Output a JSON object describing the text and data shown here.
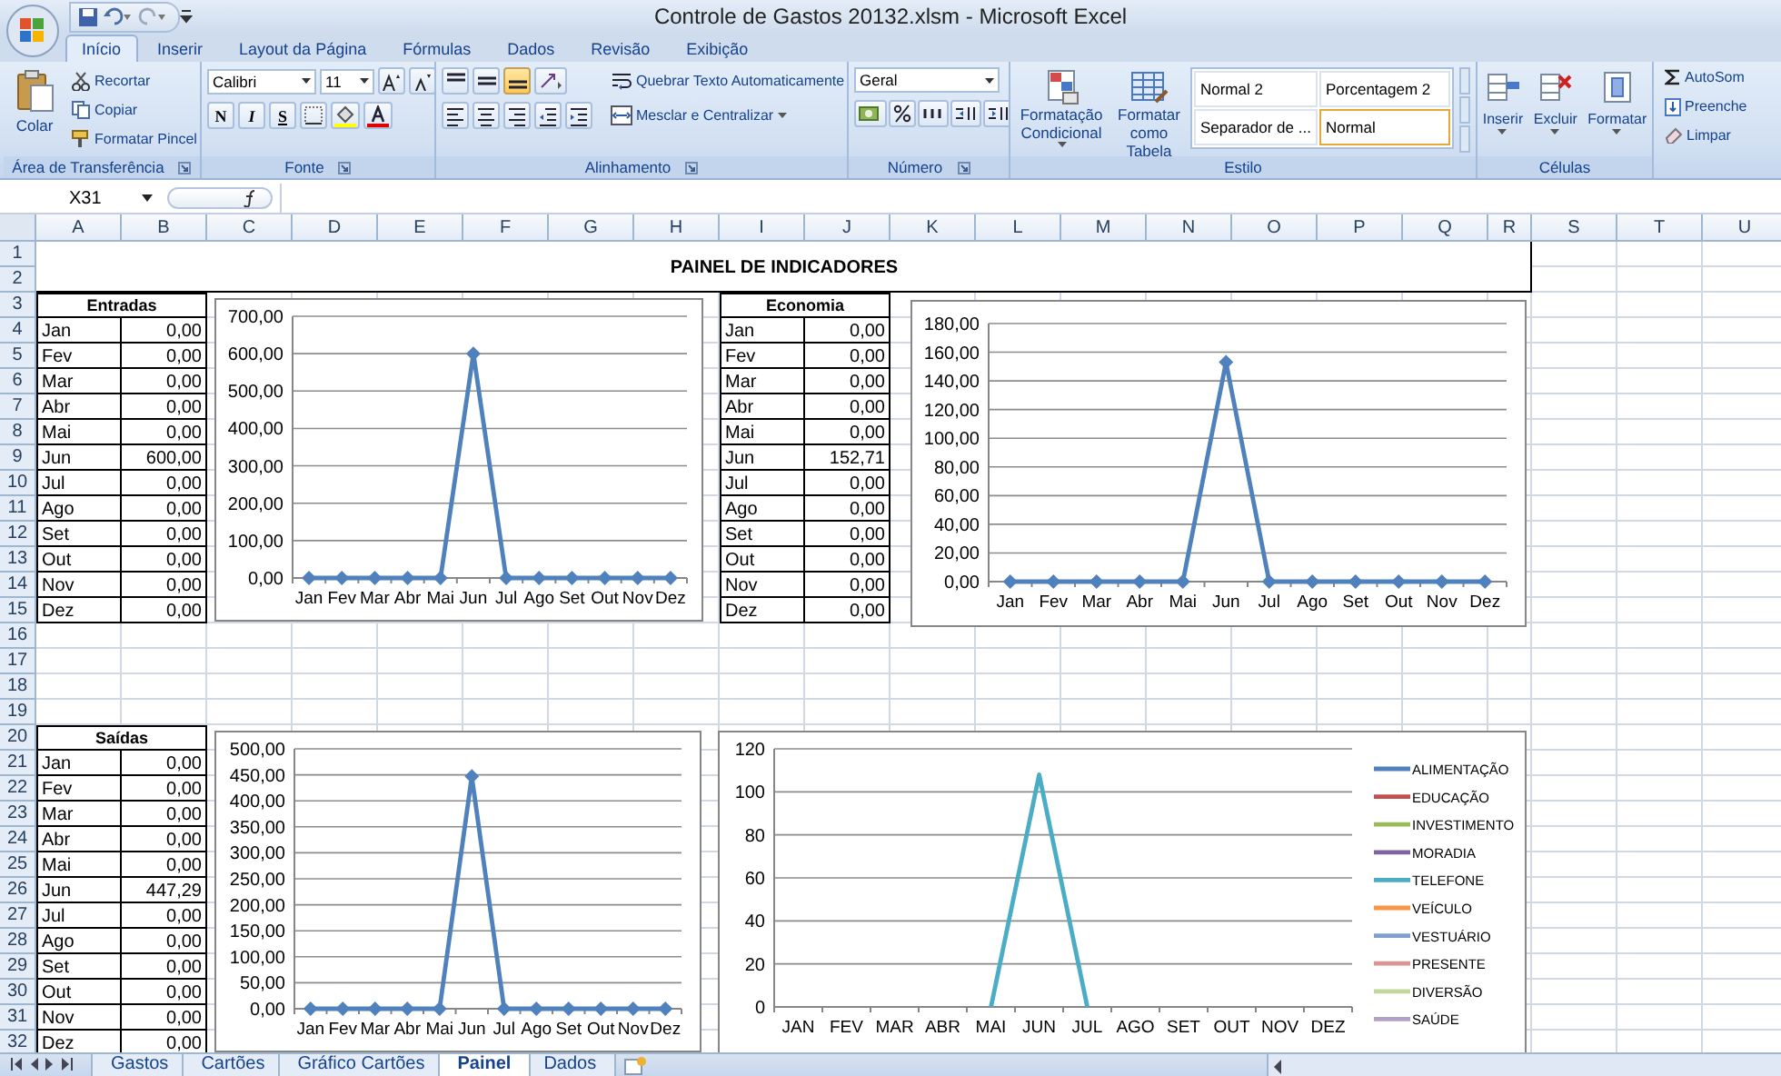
{
  "window": {
    "title": "Controle de Gastos 20132.xlsm - Microsoft Excel"
  },
  "ribbon": {
    "tabs": [
      {
        "label": "Início",
        "selected": true
      },
      {
        "label": "Inserir",
        "selected": false
      },
      {
        "label": "Layout da Página",
        "selected": false
      },
      {
        "label": "Fórmulas",
        "selected": false
      },
      {
        "label": "Dados",
        "selected": false
      },
      {
        "label": "Revisão",
        "selected": false
      },
      {
        "label": "Exibição",
        "selected": false
      }
    ],
    "groups": [
      {
        "kind": "clipboard",
        "label": "Área de Transferência",
        "big": "Colar",
        "small": [
          "Recortar",
          "Copiar",
          "Formatar Pincel"
        ]
      },
      {
        "kind": "font",
        "label": "Fonte",
        "font": "Calibri",
        "size": "11",
        "styles": [
          "N",
          "I",
          "S"
        ]
      },
      {
        "kind": "alignment",
        "label": "Alinhamento",
        "vertical_align": [
          {
            "selected": false
          },
          {
            "selected": false
          },
          {
            "selected": true
          }
        ],
        "wrap": "Quebrar Texto Automaticamente",
        "merge": "Mesclar e Centralizar"
      },
      {
        "kind": "number",
        "label": "Número",
        "format": "Geral"
      },
      {
        "kind": "styles",
        "label": "Estilo",
        "buttons": [
          "Formatação Condicional",
          "Formatar como Tabela"
        ],
        "gallery": [
          {
            "label": "Normal 2",
            "selected": false
          },
          {
            "label": "Porcentagem 2",
            "selected": false
          },
          {
            "label": "Separador de ...",
            "selected": false
          },
          {
            "label": "Normal",
            "selected": true
          }
        ]
      },
      {
        "kind": "cells",
        "label": "Células",
        "buttons": [
          "Inserir",
          "Excluir",
          "Formatar"
        ]
      },
      {
        "kind": "editing",
        "small": [
          "AutoSom",
          "Preenche",
          "Limpar"
        ]
      }
    ]
  },
  "formula_bar": {
    "name_box": "X31"
  },
  "sheet": {
    "columns": [
      "A",
      "B",
      "C",
      "D",
      "E",
      "F",
      "G",
      "H",
      "I",
      "J",
      "K",
      "L",
      "M",
      "N",
      "O",
      "P",
      "Q",
      "R",
      "S",
      "T",
      "U"
    ],
    "rows": [
      "1",
      "2",
      "3",
      "4",
      "5",
      "6",
      "7",
      "8",
      "9",
      "10",
      "11",
      "12",
      "13",
      "14",
      "15",
      "16",
      "17",
      "18",
      "19",
      "20",
      "21",
      "22",
      "23",
      "24",
      "25",
      "26",
      "27",
      "28",
      "29",
      "30",
      "31",
      "32"
    ],
    "title": "PAINEL DE INDICADORES",
    "tables": [
      {
        "heading": "Entradas",
        "rows": [
          {
            "month": "Jan",
            "value": "0,00"
          },
          {
            "month": "Fev",
            "value": "0,00"
          },
          {
            "month": "Mar",
            "value": "0,00"
          },
          {
            "month": "Abr",
            "value": "0,00"
          },
          {
            "month": "Mai",
            "value": "0,00"
          },
          {
            "month": "Jun",
            "value": "600,00"
          },
          {
            "month": "Jul",
            "value": "0,00"
          },
          {
            "month": "Ago",
            "value": "0,00"
          },
          {
            "month": "Set",
            "value": "0,00"
          },
          {
            "month": "Out",
            "value": "0,00"
          },
          {
            "month": "Nov",
            "value": "0,00"
          },
          {
            "month": "Dez",
            "value": "0,00"
          }
        ]
      },
      {
        "heading": "Economia",
        "rows": [
          {
            "month": "Jan",
            "value": "0,00"
          },
          {
            "month": "Fev",
            "value": "0,00"
          },
          {
            "month": "Mar",
            "value": "0,00"
          },
          {
            "month": "Abr",
            "value": "0,00"
          },
          {
            "month": "Mai",
            "value": "0,00"
          },
          {
            "month": "Jun",
            "value": "152,71"
          },
          {
            "month": "Jul",
            "value": "0,00"
          },
          {
            "month": "Ago",
            "value": "0,00"
          },
          {
            "month": "Set",
            "value": "0,00"
          },
          {
            "month": "Out",
            "value": "0,00"
          },
          {
            "month": "Nov",
            "value": "0,00"
          },
          {
            "month": "Dez",
            "value": "0,00"
          }
        ]
      },
      {
        "heading": "Saídas",
        "rows": [
          {
            "month": "Jan",
            "value": "0,00"
          },
          {
            "month": "Fev",
            "value": "0,00"
          },
          {
            "month": "Mar",
            "value": "0,00"
          },
          {
            "month": "Abr",
            "value": "0,00"
          },
          {
            "month": "Mai",
            "value": "0,00"
          },
          {
            "month": "Jun",
            "value": "447,29"
          },
          {
            "month": "Jul",
            "value": "0,00"
          },
          {
            "month": "Ago",
            "value": "0,00"
          },
          {
            "month": "Set",
            "value": "0,00"
          },
          {
            "month": "Out",
            "value": "0,00"
          },
          {
            "month": "Nov",
            "value": "0,00"
          },
          {
            "month": "Dez",
            "value": "0,00"
          }
        ]
      }
    ],
    "charts": [
      {
        "chart_data": {
          "type": "line",
          "grid": true,
          "categories": [
            "Jan",
            "Fev",
            "Mar",
            "Abr",
            "Mai",
            "Jun",
            "Jul",
            "Ago",
            "Set",
            "Out",
            "Nov",
            "Dez"
          ],
          "ylim": [
            0,
            700
          ],
          "yticks": [
            {
              "value": 0,
              "label": "0,00"
            },
            {
              "value": 100,
              "label": "100,00"
            },
            {
              "value": 200,
              "label": "200,00"
            },
            {
              "value": 300,
              "label": "300,00"
            },
            {
              "value": 400,
              "label": "400,00"
            },
            {
              "value": 500,
              "label": "500,00"
            },
            {
              "value": 600,
              "label": "600,00"
            },
            {
              "value": 700,
              "label": "700,00"
            }
          ],
          "series": [
            {
              "color": "#4f81bd",
              "marker": true,
              "values": [
                0,
                0,
                0,
                0,
                0,
                600,
                0,
                0,
                0,
                0,
                0,
                0
              ]
            }
          ]
        }
      },
      {
        "chart_data": {
          "type": "line",
          "grid": true,
          "categories": [
            "Jan",
            "Fev",
            "Mar",
            "Abr",
            "Mai",
            "Jun",
            "Jul",
            "Ago",
            "Set",
            "Out",
            "Nov",
            "Dez"
          ],
          "ylim": [
            0,
            180
          ],
          "yticks": [
            {
              "value": 0,
              "label": "0,00"
            },
            {
              "value": 20,
              "label": "20,00"
            },
            {
              "value": 40,
              "label": "40,00"
            },
            {
              "value": 60,
              "label": "60,00"
            },
            {
              "value": 80,
              "label": "80,00"
            },
            {
              "value": 100,
              "label": "100,00"
            },
            {
              "value": 120,
              "label": "120,00"
            },
            {
              "value": 140,
              "label": "140,00"
            },
            {
              "value": 160,
              "label": "160,00"
            },
            {
              "value": 180,
              "label": "180,00"
            }
          ],
          "series": [
            {
              "color": "#4f81bd",
              "marker": true,
              "values": [
                0,
                0,
                0,
                0,
                0,
                153,
                0,
                0,
                0,
                0,
                0,
                0
              ]
            }
          ]
        }
      },
      {
        "chart_data": {
          "type": "line",
          "grid": true,
          "categories": [
            "Jan",
            "Fev",
            "Mar",
            "Abr",
            "Mai",
            "Jun",
            "Jul",
            "Ago",
            "Set",
            "Out",
            "Nov",
            "Dez"
          ],
          "ylim": [
            0,
            500
          ],
          "yticks": [
            {
              "value": 0,
              "label": "0,00"
            },
            {
              "value": 50,
              "label": "50,00"
            },
            {
              "value": 100,
              "label": "100,00"
            },
            {
              "value": 150,
              "label": "150,00"
            },
            {
              "value": 200,
              "label": "200,00"
            },
            {
              "value": 250,
              "label": "250,00"
            },
            {
              "value": 300,
              "label": "300,00"
            },
            {
              "value": 350,
              "label": "350,00"
            },
            {
              "value": 400,
              "label": "400,00"
            },
            {
              "value": 450,
              "label": "450,00"
            },
            {
              "value": 500,
              "label": "500,00"
            }
          ],
          "series": [
            {
              "color": "#4f81bd",
              "marker": true,
              "values": [
                0,
                0,
                0,
                0,
                0,
                447,
                0,
                0,
                0,
                0,
                0,
                0
              ]
            }
          ]
        }
      },
      {
        "legend": true,
        "chart_data": {
          "type": "line",
          "grid": true,
          "categories": [
            "JAN",
            "FEV",
            "MAR",
            "ABR",
            "MAI",
            "JUN",
            "JUL",
            "AGO",
            "SET",
            "OUT",
            "NOV",
            "DEZ"
          ],
          "ylim": [
            0,
            120
          ],
          "yticks": [
            0,
            20,
            40,
            60,
            80,
            100,
            120
          ],
          "series": [
            {
              "name": "ALIMENTAÇÃO",
              "color": "#4f81bd",
              "values": [
                null,
                null,
                null,
                null,
                null,
                null,
                null,
                null,
                null,
                null,
                null,
                null
              ]
            },
            {
              "name": "EDUCAÇÃO",
              "color": "#c0504d",
              "values": [
                null,
                null,
                null,
                null,
                null,
                null,
                null,
                null,
                null,
                null,
                null,
                null
              ]
            },
            {
              "name": "INVESTIMENTO",
              "color": "#9bbb59",
              "values": [
                null,
                null,
                null,
                null,
                null,
                null,
                null,
                null,
                null,
                null,
                null,
                null
              ]
            },
            {
              "name": "MORADIA",
              "color": "#8064a2",
              "values": [
                null,
                null,
                null,
                null,
                null,
                null,
                null,
                null,
                null,
                null,
                null,
                null
              ]
            },
            {
              "name": "TELEFONE",
              "color": "#4bacc6",
              "values": [
                null,
                null,
                null,
                null,
                0,
                108,
                0,
                null,
                null,
                null,
                null,
                null
              ]
            },
            {
              "name": "VEÍCULO",
              "color": "#f79646",
              "values": [
                null,
                null,
                null,
                null,
                null,
                null,
                null,
                null,
                null,
                null,
                null,
                null
              ]
            },
            {
              "name": "VESTUÁRIO",
              "color": "#7f9fd0",
              "values": [
                null,
                null,
                null,
                null,
                null,
                null,
                null,
                null,
                null,
                null,
                null,
                null
              ]
            },
            {
              "name": "PRESENTE",
              "color": "#d99694",
              "values": [
                null,
                null,
                null,
                null,
                null,
                null,
                null,
                null,
                null,
                null,
                null,
                null
              ]
            },
            {
              "name": "DIVERSÃO",
              "color": "#c3d69b",
              "values": [
                null,
                null,
                null,
                null,
                null,
                null,
                null,
                null,
                null,
                null,
                null,
                null
              ]
            },
            {
              "name": "SAÚDE",
              "color": "#b3a2c7",
              "values": [
                null,
                null,
                null,
                null,
                null,
                null,
                null,
                null,
                null,
                null,
                null,
                null
              ]
            }
          ]
        }
      }
    ]
  },
  "sheet_tabs": [
    {
      "label": "Gastos",
      "selected": false
    },
    {
      "label": "Cartões",
      "selected": false
    },
    {
      "label": "Gráfico Cartões",
      "selected": false
    },
    {
      "label": "Painel",
      "selected": true
    },
    {
      "label": "Dados",
      "selected": false
    }
  ]
}
